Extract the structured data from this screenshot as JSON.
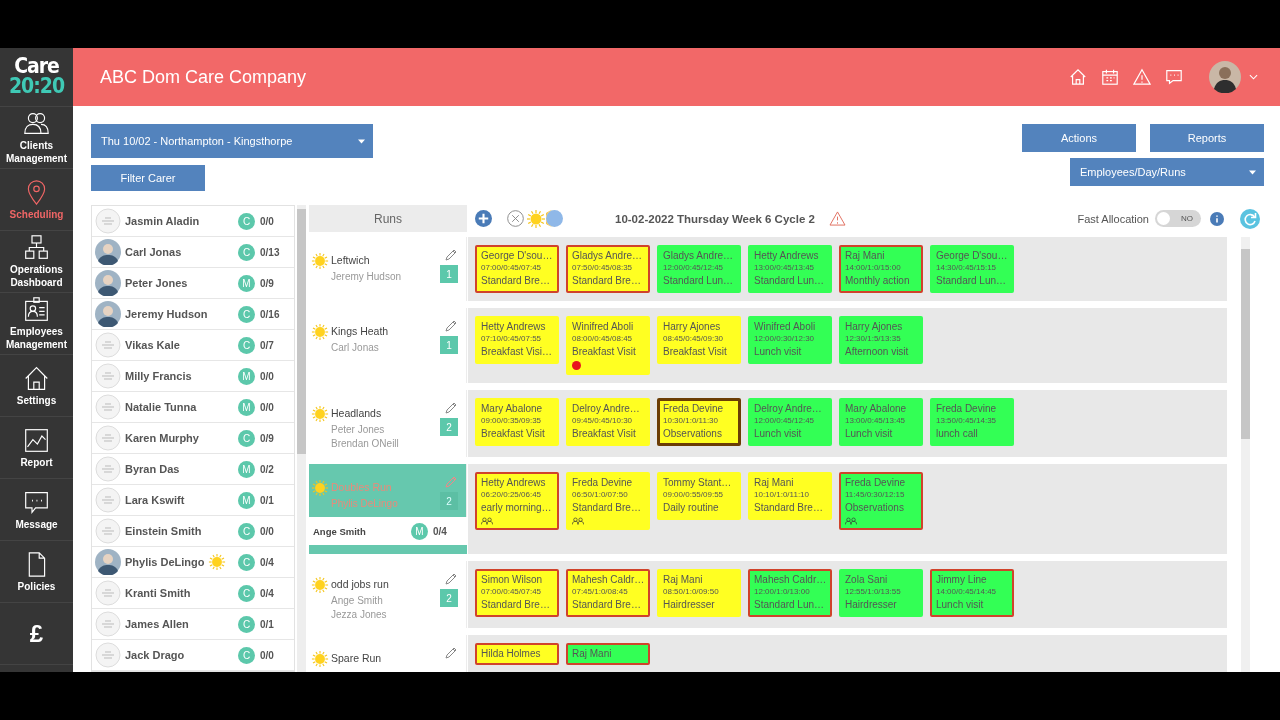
{
  "sidebar": {
    "logo": {
      "line1": "Care",
      "line2": "20:20"
    },
    "items": [
      {
        "label": "Clients Management",
        "selected": false
      },
      {
        "label": "Scheduling",
        "selected": true
      },
      {
        "label": "Operations Dashboard",
        "selected": false
      },
      {
        "label": "Employees Management",
        "selected": false
      },
      {
        "label": "Settings",
        "selected": false
      },
      {
        "label": "Report",
        "selected": false
      },
      {
        "label": "Message",
        "selected": false
      },
      {
        "label": "Policies",
        "selected": false
      },
      {
        "glyph": "£",
        "selected": false
      }
    ]
  },
  "header": {
    "title": "ABC Dom Care Company"
  },
  "toolbar": {
    "location": "Thu 10/02 - Northampton - Kingsthorpe",
    "filter_button": "Filter Carer",
    "actions_button": "Actions",
    "reports_button": "Reports",
    "view": "Employees/Day/Runs"
  },
  "employees": [
    {
      "name": "Jasmin Aladin",
      "kind": "placeholder",
      "role": "C",
      "count": "0/0",
      "sun": false
    },
    {
      "name": "Carl Jonas",
      "kind": "photo",
      "role": "C",
      "count": "0/13",
      "sun": false
    },
    {
      "name": "Peter Jones",
      "kind": "photo",
      "role": "M",
      "count": "0/9",
      "sun": false
    },
    {
      "name": "Jeremy Hudson",
      "kind": "photo",
      "role": "C",
      "count": "0/16",
      "sun": false
    },
    {
      "name": "Vikas Kale",
      "kind": "placeholder",
      "role": "C",
      "count": "0/7",
      "sun": false
    },
    {
      "name": "Milly Francis",
      "kind": "placeholder",
      "role": "M",
      "count": "0/0",
      "sun": false
    },
    {
      "name": "Natalie Tunna",
      "kind": "placeholder",
      "role": "M",
      "count": "0/0",
      "sun": false
    },
    {
      "name": "Karen Murphy",
      "kind": "placeholder",
      "role": "C",
      "count": "0/9",
      "sun": false
    },
    {
      "name": "Byran Das",
      "kind": "placeholder",
      "role": "M",
      "count": "0/2",
      "sun": false
    },
    {
      "name": "Lara Kswift",
      "kind": "placeholder",
      "role": "M",
      "count": "0/1",
      "sun": false
    },
    {
      "name": "Einstein Smith",
      "kind": "placeholder",
      "role": "C",
      "count": "0/0",
      "sun": false
    },
    {
      "name": "Phylis DeLingo",
      "kind": "photo",
      "role": "C",
      "count": "0/4",
      "sun": true
    },
    {
      "name": "Kranti Smith",
      "kind": "placeholder",
      "role": "C",
      "count": "0/4",
      "sun": false
    },
    {
      "name": "James Allen",
      "kind": "placeholder",
      "role": "C",
      "count": "0/1",
      "sun": false
    },
    {
      "name": "Jack Drago",
      "kind": "placeholder",
      "role": "C",
      "count": "0/0",
      "sun": false
    }
  ],
  "schedule": {
    "runs_heading": "Runs",
    "date_title": "10-02-2022 Thursday Week 6 Cycle 2",
    "fast_allocation": {
      "label": "Fast Allocation",
      "toggle_text": "NO",
      "on": false
    }
  },
  "runs": [
    {
      "name": "Leftwich",
      "staff": [
        "Jeremy Hudson"
      ],
      "count": "1",
      "selected": false,
      "visits": [
        {
          "client": "George D'sou…",
          "time": "07:00/0:45/07:45",
          "type": "Standard Bre…",
          "color": "#ffff22",
          "flagged": true,
          "noted": false,
          "group": false,
          "dot": false
        },
        {
          "client": "Gladys Andre…",
          "time": "07:50/0:45/08:35",
          "type": "Standard Bre…",
          "color": "#ffff22",
          "flagged": true,
          "noted": false,
          "group": false,
          "dot": false
        },
        {
          "client": "Gladys Andre…",
          "time": "12:00/0:45/12:45",
          "type": "Standard Lun…",
          "color": "#33ff55",
          "flagged": false,
          "noted": false,
          "group": false,
          "dot": false
        },
        {
          "client": "Hetty Andrews",
          "time": "13:00/0:45/13:45",
          "type": "Standard Lun…",
          "color": "#33ff55",
          "flagged": false,
          "noted": false,
          "group": false,
          "dot": false
        },
        {
          "client": "Raj Mani",
          "time": "14:00/1:0/15:00",
          "type": "Monthly action",
          "color": "#33ff55",
          "flagged": true,
          "noted": false,
          "group": false,
          "dot": false
        },
        {
          "client": "George D'sou…",
          "time": "14:30/0:45/15:15",
          "type": "Standard Lun…",
          "color": "#33ff55",
          "flagged": false,
          "noted": false,
          "group": false,
          "dot": false
        }
      ]
    },
    {
      "name": "Kings Heath",
      "staff": [
        "Carl Jonas"
      ],
      "count": "1",
      "selected": false,
      "visits": [
        {
          "client": "Hetty Andrews",
          "time": "07:10/0:45/07:55",
          "type": "Breakfast Visi…",
          "color": "#ffff22",
          "flagged": false,
          "noted": false,
          "group": false,
          "dot": false
        },
        {
          "client": "Winifred Aboli",
          "time": "08:00/0:45/08:45",
          "type": "Breakfast Visit",
          "color": "#ffff22",
          "flagged": false,
          "noted": false,
          "group": false,
          "dot": true
        },
        {
          "client": "Harry Ajones",
          "time": "08:45/0:45/09:30",
          "type": "Breakfast Visit",
          "color": "#ffff22",
          "flagged": false,
          "noted": false,
          "group": false,
          "dot": false
        },
        {
          "client": "Winifred Aboli",
          "time": "12:00/0:30/12:30",
          "type": "Lunch visit",
          "color": "#33ff55",
          "flagged": false,
          "noted": false,
          "group": false,
          "dot": false
        },
        {
          "client": "Harry Ajones",
          "time": "12:30/1:5/13:35",
          "type": "Afternoon visit",
          "color": "#33ff55",
          "flagged": false,
          "noted": false,
          "group": false,
          "dot": false
        }
      ]
    },
    {
      "name": "Headlands",
      "staff": [
        "Peter Jones",
        "Brendan ONeill"
      ],
      "count": "2",
      "selected": false,
      "visits": [
        {
          "client": "Mary Abalone",
          "time": "09:00/0:35/09:35",
          "type": "Breakfast Visit",
          "color": "#ffff22",
          "flagged": false,
          "noted": false,
          "group": false,
          "dot": false
        },
        {
          "client": "Delroy Andre…",
          "time": "09:45/0:45/10:30",
          "type": "Breakfast Visit",
          "color": "#ffff22",
          "flagged": false,
          "noted": false,
          "group": false,
          "dot": false
        },
        {
          "client": "Freda Devine",
          "time": "10:30/1:0/11:30",
          "type": "Observations",
          "color": "#ffff22",
          "flagged": false,
          "noted": true,
          "group": false,
          "dot": false
        },
        {
          "client": "Delroy Andre…",
          "time": "12:00/0:45/12:45",
          "type": "Lunch visit",
          "color": "#33ff55",
          "flagged": false,
          "noted": false,
          "group": false,
          "dot": false
        },
        {
          "client": "Mary Abalone",
          "time": "13:00/0:45/13:45",
          "type": "Lunch visit",
          "color": "#33ff55",
          "flagged": false,
          "noted": false,
          "group": false,
          "dot": false
        },
        {
          "client": "Freda Devine",
          "time": "13:50/0:45/14:35",
          "type": "lunch call",
          "color": "#33ff55",
          "flagged": false,
          "noted": false,
          "group": false,
          "dot": false
        }
      ]
    },
    {
      "name": "Doubles Run",
      "staff": [
        "Phylis DeLingo"
      ],
      "count": "2",
      "selected": true,
      "dropped": {
        "name": "Ange Smith",
        "role": "M",
        "count": "0/4"
      },
      "visits": [
        {
          "client": "Hetty Andrews",
          "time": "06:20/0:25/06:45",
          "type": "early morning…",
          "color": "#ffff22",
          "flagged": true,
          "noted": false,
          "group": true,
          "dot": false
        },
        {
          "client": "Freda Devine",
          "time": "06:50/1:0/07:50",
          "type": "Standard Bre…",
          "color": "#ffff22",
          "flagged": false,
          "noted": false,
          "group": true,
          "dot": false
        },
        {
          "client": "Tommy Stant…",
          "time": "09:00/0:55/09:55",
          "type": "Daily routine",
          "color": "#ffff22",
          "flagged": false,
          "noted": false,
          "group": false,
          "dot": false
        },
        {
          "client": "Raj Mani",
          "time": "10:10/1:0/11:10",
          "type": "Standard Bre…",
          "color": "#ffff22",
          "flagged": false,
          "noted": false,
          "group": false,
          "dot": false
        },
        {
          "client": "Freda Devine",
          "time": "11:45/0:30/12:15",
          "type": "Observations",
          "color": "#33ff55",
          "flagged": true,
          "noted": false,
          "group": true,
          "dot": false
        }
      ]
    },
    {
      "name": "odd jobs run",
      "staff": [
        "Ange Smith",
        "Jezza Jones"
      ],
      "count": "2",
      "selected": false,
      "visits": [
        {
          "client": "Simon Wilson",
          "time": "07:00/0:45/07:45",
          "type": "Standard Bre…",
          "color": "#ffff22",
          "flagged": true,
          "noted": false,
          "group": false,
          "dot": false
        },
        {
          "client": "Mahesh Caldr…",
          "time": "07:45/1:0/08:45",
          "type": "Standard Bre…",
          "color": "#ffff22",
          "flagged": true,
          "noted": false,
          "group": false,
          "dot": false
        },
        {
          "client": "Raj Mani",
          "time": "08:50/1:0/09:50",
          "type": "Hairdresser",
          "color": "#ffff22",
          "flagged": false,
          "noted": false,
          "group": false,
          "dot": false
        },
        {
          "client": "Mahesh Caldr…",
          "time": "12:00/1:0/13:00",
          "type": "Standard Lun…",
          "color": "#33ff55",
          "flagged": true,
          "noted": false,
          "group": false,
          "dot": false
        },
        {
          "client": "Zola Sani",
          "time": "12:55/1:0/13:55",
          "type": "Hairdresser",
          "color": "#33ff55",
          "flagged": false,
          "noted": false,
          "group": false,
          "dot": false
        },
        {
          "client": "Jimmy Line",
          "time": "14:00/0:45/14:45",
          "type": "Lunch visit",
          "color": "#33ff55",
          "flagged": true,
          "noted": false,
          "group": false,
          "dot": false
        }
      ]
    },
    {
      "name": "Spare Run",
      "selected": false,
      "visits": [
        {
          "client": "Hilda Holmes",
          "color": "#ffff22",
          "flagged": true,
          "noted": false,
          "group": false,
          "dot": false
        },
        {
          "client": "Raj Mani",
          "color": "#33ff55",
          "flagged": true,
          "noted": false,
          "group": false,
          "dot": false
        }
      ]
    }
  ]
}
